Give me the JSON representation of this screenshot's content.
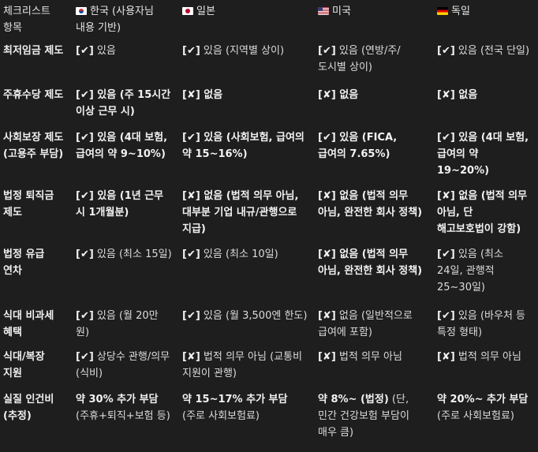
{
  "header": {
    "col0": "체크리스트 항목",
    "col1": "한국 (사용자님 내용 기반)",
    "col2": "일본",
    "col3": "미국",
    "col4": "독일",
    "flag1": "kr-flag-icon",
    "flag2": "jp-flag-icon",
    "flag3": "us-flag-icon",
    "flag4": "de-flag-icon"
  },
  "rows": [
    {
      "label": "최저임금 제도",
      "kr": {
        "mark": "[✔]",
        "text": " 있음",
        "bold": false
      },
      "jp": {
        "mark": "[✔]",
        "text": " 있음 (지역별 상이)",
        "bold": false
      },
      "us": {
        "mark": "[✔]",
        "text": " 있음 (연방/주/도시별 상이)",
        "bold": false
      },
      "de": {
        "mark": "[✔]",
        "text": " 있음 (전국 단일)",
        "bold": false
      }
    },
    {
      "label": "주휴수당 제도",
      "kr": {
        "mark": "[✔]",
        "text": " 있음 (주 15시간 이상 근무 시)",
        "bold": true
      },
      "jp": {
        "mark": "[✘]",
        "text": " 없음",
        "bold": true
      },
      "us": {
        "mark": "[✘]",
        "text": " 없음",
        "bold": true
      },
      "de": {
        "mark": "[✘]",
        "text": " 없음",
        "bold": true
      }
    },
    {
      "label": "사회보장 제도 (고용주 부담)",
      "kr": {
        "mark": "[✔]",
        "text": " 있음 (4대 보험, 급여의 약 9~10%)",
        "bold": true
      },
      "jp": {
        "mark": "[✔]",
        "text": " 있음 (사회보험, 급여의 약 15~16%)",
        "bold": true
      },
      "us": {
        "mark": "[✔]",
        "text": " 있음 (FICA, 급여의 7.65%)",
        "bold": true
      },
      "de": {
        "mark": "[✔]",
        "text": " 있음 (4대 보험, 급여의 약 19~20%)",
        "bold": true
      }
    },
    {
      "label": "법정 퇴직금 제도",
      "kr": {
        "mark": "[✔]",
        "text": " 있음 (1년 근무 시 1개월분)",
        "bold": true
      },
      "jp": {
        "mark": "[✘]",
        "text": " 없음 (법적 의무 아님, 대부분 기업 내규/관행으로 지급)",
        "bold": true
      },
      "us": {
        "mark": "[✘]",
        "text": " 없음 (법적 의무 아님, 완전한 회사 정책)",
        "bold": true
      },
      "de": {
        "mark": "[✘]",
        "text": " 없음 (법적 의무 아님, 단 해고보호법이 강함)",
        "bold": true
      }
    },
    {
      "label": "법정 유급 연차",
      "kr": {
        "mark": "[✔]",
        "text": " 있음 (최소 15일)",
        "bold": false
      },
      "jp": {
        "mark": "[✔]",
        "text": " 있음 (최소 10일)",
        "bold": false
      },
      "us": {
        "mark": "[✘]",
        "text": " 없음 (법적 의무 아님, 완전한 회사 정책)",
        "bold": true
      },
      "de": {
        "mark": "[✔]",
        "text": " 있음 (최소 24일, 관행적 25~30일)",
        "bold": false
      }
    },
    {
      "label": "식대 비과세 혜택",
      "kr": {
        "mark": "[✔]",
        "text": " 있음 (월 20만 원)",
        "bold": false
      },
      "jp": {
        "mark": "[✔]",
        "text": " 있음 (월 3,500엔 한도)",
        "bold": false
      },
      "us": {
        "mark": "[✘]",
        "text": " 없음 (일반적으로 급여에 포함)",
        "bold": false
      },
      "de": {
        "mark": "[✔]",
        "text": " 있음 (바우처 등 특정 형태)",
        "bold": false
      }
    },
    {
      "label": "식대/복장 지원",
      "kr": {
        "mark": "[✔]",
        "text": " 상당수 관행/의무 (식비)",
        "bold": false
      },
      "jp": {
        "mark": "[✘]",
        "text": " 법적 의무 아님 (교통비 지원이 관행)",
        "bold": false
      },
      "us": {
        "mark": "[✘]",
        "text": " 법적 의무 아님",
        "bold": false
      },
      "de": {
        "mark": "[✘]",
        "text": " 법적 의무 아님",
        "bold": false
      }
    },
    {
      "label": "실질 인건비 (추정)",
      "kr": {
        "strong": "약 30% 추가 부담",
        "rest": " (주휴+퇴직+보험 등)"
      },
      "jp": {
        "strong": "약 15~17% 추가 부담",
        "rest": " (주로 사회보험료)"
      },
      "us": {
        "strong": "약 8%~ (법정)",
        "rest": " (단, 민간 건강보험 부담이 매우 큼)"
      },
      "de": {
        "strong": "약 20%~ 추가 부담",
        "rest": " (주로 사회보험료)"
      }
    }
  ]
}
